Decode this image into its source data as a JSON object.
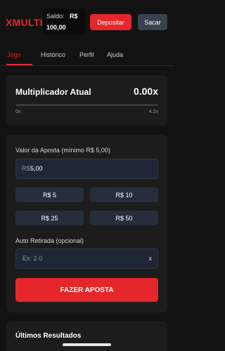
{
  "header": {
    "logo": "XMULTI",
    "balance_label": "Saldo:",
    "balance_currency": "R$",
    "balance_value": "100,00",
    "deposit_label": "Depositar",
    "withdraw_label": "Sacar"
  },
  "tabs": [
    {
      "label": "Jogo",
      "active": true
    },
    {
      "label": "Histórico",
      "active": false
    },
    {
      "label": "Perfil",
      "active": false
    },
    {
      "label": "Ajuda",
      "active": false
    }
  ],
  "multiplier": {
    "title": "Multiplicador Atual",
    "value": "0.00x",
    "min_label": "0x",
    "max_label": "4.2x",
    "progress": 0.0
  },
  "bet": {
    "amount_label": "Valor da Aposta (mínimo R$ 5,00)",
    "amount_prefix": "R$",
    "amount_value": "5,00",
    "quick_amounts": [
      "R$ 5",
      "R$ 10",
      "R$ 25",
      "R$ 50"
    ],
    "auto_label": "Auto Retirada (opcional)",
    "auto_placeholder": "Ex: 2.0",
    "auto_clear": "x",
    "submit_label": "FAZER APOSTA"
  },
  "results": {
    "title": "Últimos Resultados"
  },
  "colors": {
    "accent": "#e5262b",
    "background": "#121212",
    "card": "#1c1c1c",
    "input": "#1f2736",
    "quick_button": "#262e3c",
    "secondary_button": "#3a4250"
  }
}
